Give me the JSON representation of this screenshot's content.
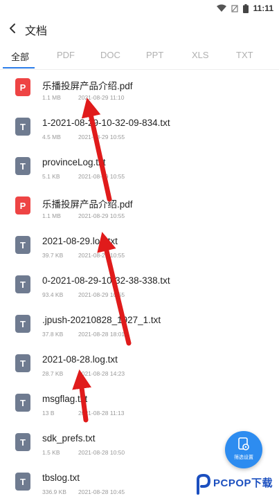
{
  "status_bar": {
    "time": "11:11"
  },
  "header": {
    "title": "文档"
  },
  "tabs": [
    {
      "label": "全部",
      "active": true
    },
    {
      "label": "PDF"
    },
    {
      "label": "DOC"
    },
    {
      "label": "PPT"
    },
    {
      "label": "XLS"
    },
    {
      "label": "TXT"
    }
  ],
  "files": [
    {
      "name": "乐播投屏产品介绍.pdf",
      "size": "1.1 MB",
      "date": "2021-08-29 11:10",
      "type": "pdf",
      "icon_letter": "P"
    },
    {
      "name": "1-2021-08-29-10-32-09-834.txt",
      "size": "4.5 MB",
      "date": "2021-08-29 10:55",
      "type": "txt",
      "icon_letter": "T"
    },
    {
      "name": "provinceLog.txt",
      "size": "5.1 KB",
      "date": "2021-08-29 10:55",
      "type": "txt",
      "icon_letter": "T"
    },
    {
      "name": "乐播投屏产品介绍.pdf",
      "size": "1.1 MB",
      "date": "2021-08-29 10:55",
      "type": "pdf",
      "icon_letter": "P"
    },
    {
      "name": "2021-08-29.log.txt",
      "size": "39.7 KB",
      "date": "2021-08-29 10:55",
      "type": "txt",
      "icon_letter": "T"
    },
    {
      "name": "0-2021-08-29-10-32-38-338.txt",
      "size": "93.4 KB",
      "date": "2021-08-29 10:55",
      "type": "txt",
      "icon_letter": "T"
    },
    {
      "name": ".jpush-20210828_1927_1.txt",
      "size": "37.8 KB",
      "date": "2021-08-28 18:01",
      "type": "txt",
      "icon_letter": "T"
    },
    {
      "name": "2021-08-28.log.txt",
      "size": "28.7 KB",
      "date": "2021-08-28 14:23",
      "type": "txt",
      "icon_letter": "T"
    },
    {
      "name": "msgflag.txt",
      "size": "13 B",
      "date": "2021-08-28 11:13",
      "type": "txt",
      "icon_letter": "T"
    },
    {
      "name": "sdk_prefs.txt",
      "size": "1.5 KB",
      "date": "2021-08-28 10:50",
      "type": "txt",
      "icon_letter": "T"
    },
    {
      "name": "tbslog.txt",
      "size": "336.9 KB",
      "date": "2021-08-28 10:45",
      "type": "txt",
      "icon_letter": "T"
    }
  ],
  "fab": {
    "label": "筛选设置",
    "icon": "filter-settings-icon"
  },
  "watermark": {
    "text": "PCPOP下载"
  },
  "colors": {
    "accent": "#2b7de9",
    "pdf": "#ee4444",
    "txt": "#6f7b90",
    "arrow": "#e01b1b"
  }
}
